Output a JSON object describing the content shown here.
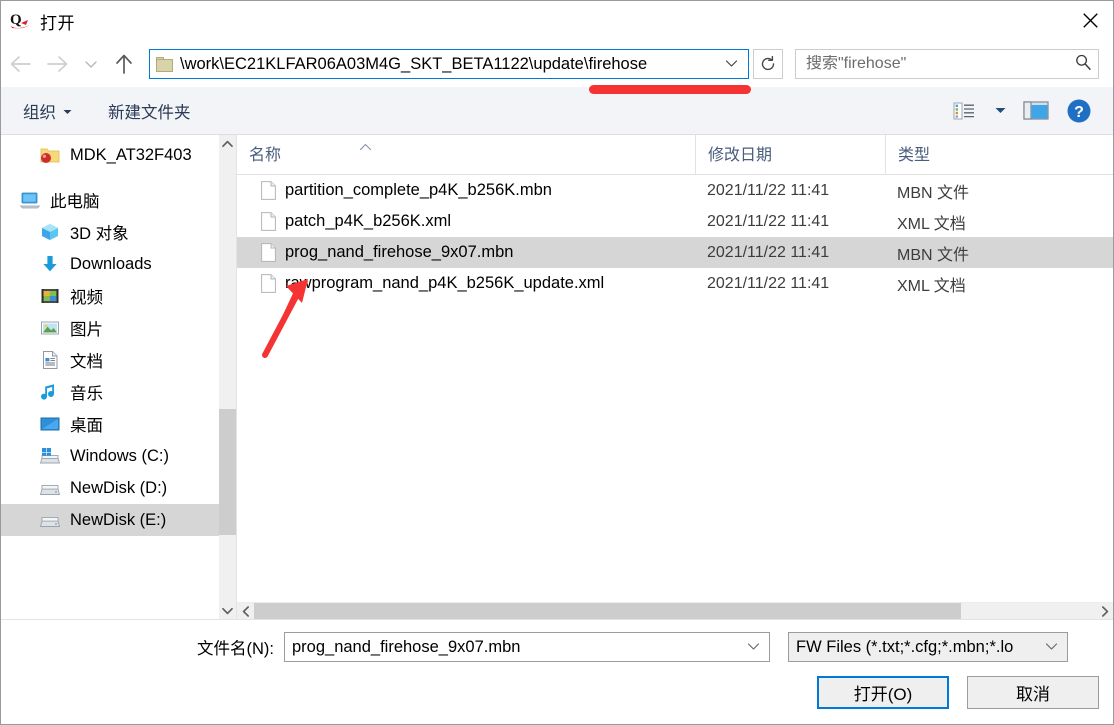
{
  "window": {
    "title": "打开",
    "app_icon": "quectel-q-logo",
    "close_label": "✕"
  },
  "nav": {
    "back_icon": "arrow-left-icon",
    "forward_icon": "arrow-right-icon",
    "recent_icon": "chevron-down-icon",
    "up_icon": "arrow-up-icon",
    "refresh_icon": "refresh-icon",
    "address": {
      "icon": "folder-icon",
      "path": "\\work\\EC21KLFAR06A03M4G_SKT_BETA1122\\update\\firehose",
      "dropdown_icon": "chevron-down-icon"
    },
    "search": {
      "icon": "search-icon",
      "value": "",
      "placeholder": "搜索\"firehose\""
    }
  },
  "commandbar": {
    "organize_label": "组织",
    "organize_caret": "caret-down-icon",
    "new_folder_label": "新建文件夹",
    "view_options_icon": "view-list-icon",
    "view_caret_icon": "caret-down-icon",
    "preview_pane_icon": "preview-pane-icon",
    "help_icon": "help-icon"
  },
  "sidebar": {
    "scroll_up_icon": "chevron-up-icon",
    "scroll_down_icon": "chevron-down-icon",
    "items": [
      {
        "label": "MDK_AT32F403",
        "icon": "folder-favorite-icon",
        "indent": 1,
        "selected": false,
        "truncated": true
      },
      {
        "label": "此电脑",
        "icon": "this-pc-icon",
        "indent": 0,
        "selected": false
      },
      {
        "label": "3D 对象",
        "icon": "3d-objects-icon",
        "indent": 1,
        "selected": false
      },
      {
        "label": "Downloads",
        "icon": "downloads-icon",
        "indent": 1,
        "selected": false
      },
      {
        "label": "视频",
        "icon": "videos-icon",
        "indent": 1,
        "selected": false
      },
      {
        "label": "图片",
        "icon": "pictures-icon",
        "indent": 1,
        "selected": false
      },
      {
        "label": "文档",
        "icon": "documents-icon",
        "indent": 1,
        "selected": false
      },
      {
        "label": "音乐",
        "icon": "music-icon",
        "indent": 1,
        "selected": false
      },
      {
        "label": "桌面",
        "icon": "desktop-icon",
        "indent": 1,
        "selected": false
      },
      {
        "label": "Windows (C:)",
        "icon": "windows-drive-icon",
        "indent": 1,
        "selected": false
      },
      {
        "label": "NewDisk (D:)",
        "icon": "drive-icon",
        "indent": 1,
        "selected": false
      },
      {
        "label": "NewDisk (E:)",
        "icon": "drive-icon",
        "indent": 1,
        "selected": true
      }
    ]
  },
  "filelist": {
    "columns": [
      {
        "key": "name",
        "label": "名称",
        "sorted": "asc",
        "sort_icon": "sort-asc-icon"
      },
      {
        "key": "date",
        "label": "修改日期",
        "sorted": "",
        "sort_icon": ""
      },
      {
        "key": "type",
        "label": "类型",
        "sorted": "",
        "sort_icon": ""
      }
    ],
    "rows": [
      {
        "name": "partition_complete_p4K_b256K.mbn",
        "date": "2021/11/22 11:41",
        "type": "MBN 文件",
        "icon": "file-icon",
        "selected": false
      },
      {
        "name": "patch_p4K_b256K.xml",
        "date": "2021/11/22 11:41",
        "type": "XML 文档",
        "icon": "file-icon",
        "selected": false
      },
      {
        "name": "prog_nand_firehose_9x07.mbn",
        "date": "2021/11/22 11:41",
        "type": "MBN 文件",
        "icon": "file-icon",
        "selected": true
      },
      {
        "name": "rawprogram_nand_p4K_b256K_update.xml",
        "date": "2021/11/22 11:41",
        "type": "XML 文档",
        "icon": "file-icon",
        "selected": false
      }
    ],
    "hscroll_left_icon": "chevron-left-icon",
    "hscroll_right_icon": "chevron-right-icon"
  },
  "footer": {
    "filename_label": "文件名(N):",
    "filename_value": "prog_nand_firehose_9x07.mbn",
    "filename_placeholder": "",
    "filename_dropdown_icon": "chevron-down-icon",
    "filter_value": "FW Files (*.txt;*.cfg;*.mbn;*.lo",
    "filter_dropdown_icon": "chevron-down-icon",
    "open_button": "打开(O)",
    "cancel_button": "取消"
  },
  "annotations": {
    "underline_color": "#f53333",
    "arrow_color": "#f53333",
    "underline_name": "red-underline-annotation",
    "arrow_name": "red-arrow-annotation"
  },
  "colors": {
    "accent": "#0078d7",
    "selection": "#d6d6d6",
    "commandbar_bg": "#f2f4f7",
    "header_text": "#4a5d7e"
  }
}
